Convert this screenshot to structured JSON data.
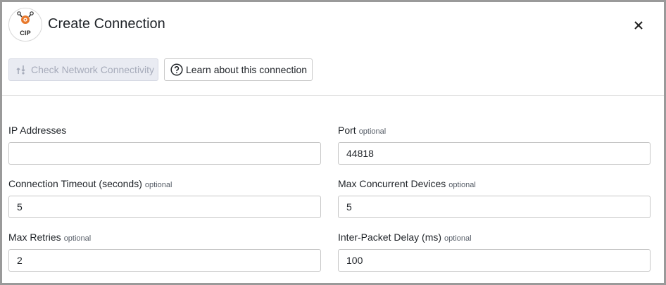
{
  "dialog": {
    "title": "Create Connection",
    "logo_text": "CIP",
    "close_label": "×"
  },
  "toolbar": {
    "check_label": "Check Network Connectivity",
    "learn_label": "Learn about this connection"
  },
  "form": {
    "optional_tag": "optional",
    "fields": [
      {
        "label": "IP Addresses",
        "value": "",
        "optional": false
      },
      {
        "label": "Port",
        "value": "44818",
        "optional": true
      },
      {
        "label": "Connection Timeout (seconds)",
        "value": "5",
        "optional": true
      },
      {
        "label": "Max Concurrent Devices",
        "value": "5",
        "optional": true
      },
      {
        "label": "Max Retries",
        "value": "2",
        "optional": true
      },
      {
        "label": "Inter-Packet Delay (ms)",
        "value": "100",
        "optional": true
      }
    ]
  },
  "colors": {
    "logo_accent": "#e8792c",
    "border": "#9a9a9a",
    "disabled_button_bg": "#e9ebf2"
  }
}
